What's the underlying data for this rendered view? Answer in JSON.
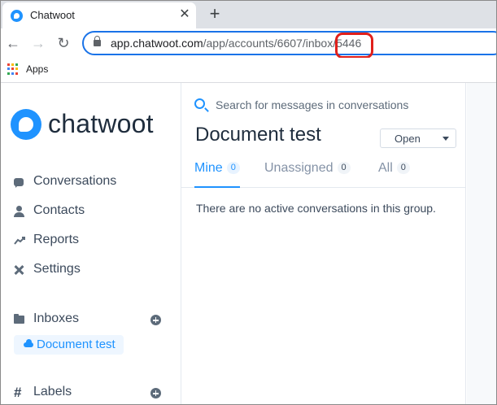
{
  "browser": {
    "tab_title": "Chatwoot",
    "tab_close_glyph": "✕",
    "new_tab_glyph": "+",
    "back_glyph": "←",
    "forward_glyph": "→",
    "reload_glyph": "↻",
    "url_host": "app.chatwoot.com",
    "url_path": "/app/accounts/6607/inbox/5446",
    "bookmark_apps": "Apps",
    "apps_colors": [
      "#ea4335",
      "#fbbc05",
      "#34a853",
      "#4285f4",
      "#ea4335",
      "#fbbc05",
      "#34a853",
      "#4285f4",
      "#ea4335"
    ]
  },
  "app": {
    "brand_name": "chatwoot",
    "brand_color": "#1f93ff",
    "nav": {
      "conversations": "Conversations",
      "contacts": "Contacts",
      "reports": "Reports",
      "settings": "Settings"
    },
    "inboxes": {
      "heading": "Inboxes",
      "items": [
        {
          "label": "Document test"
        }
      ]
    },
    "labels": {
      "heading": "Labels",
      "hash_glyph": "#"
    }
  },
  "conversations": {
    "search_placeholder": "Search for messages in conversations",
    "inbox_title": "Document test",
    "status_filter": "Open",
    "tabs": [
      {
        "label": "Mine",
        "count": "0",
        "active": true
      },
      {
        "label": "Unassigned",
        "count": "0",
        "active": false
      },
      {
        "label": "All",
        "count": "0",
        "active": false
      }
    ],
    "empty_message": "There are no active conversations in this group."
  }
}
